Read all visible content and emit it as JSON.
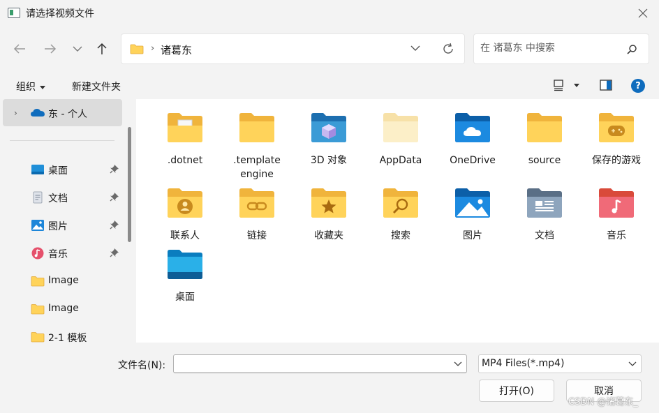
{
  "window": {
    "title": "请选择视频文件"
  },
  "nav": {
    "address_path": "诸葛东",
    "search_placeholder": "在 诸葛东 中搜索"
  },
  "toolbar": {
    "organize_label": "组织",
    "new_folder_label": "新建文件夹"
  },
  "sidebar": {
    "onedrive_label": "东 - 个人",
    "items": [
      {
        "label": "桌面",
        "icon": "desktop-icon",
        "pinned": true
      },
      {
        "label": "文档",
        "icon": "documents-icon",
        "pinned": true
      },
      {
        "label": "图片",
        "icon": "pictures-icon",
        "pinned": true
      },
      {
        "label": "音乐",
        "icon": "music-icon",
        "pinned": true
      },
      {
        "label": "Image",
        "icon": "folder-icon",
        "pinned": false
      },
      {
        "label": "Image",
        "icon": "folder-icon",
        "pinned": false
      },
      {
        "label": "2-1 模板",
        "icon": "folder-icon",
        "pinned": false
      }
    ]
  },
  "content": {
    "items": [
      {
        "label": ".dotnet",
        "icon": "folder-file-icon"
      },
      {
        "label": ".template engine",
        "icon": "folder-icon"
      },
      {
        "label": "3D 对象",
        "icon": "3d-objects-icon"
      },
      {
        "label": "AppData",
        "icon": "hidden-folder-icon"
      },
      {
        "label": "OneDrive",
        "icon": "onedrive-folder-icon"
      },
      {
        "label": "source",
        "icon": "folder-icon"
      },
      {
        "label": "保存的游戏",
        "icon": "saved-games-icon"
      },
      {
        "label": "联系人",
        "icon": "contacts-icon"
      },
      {
        "label": "链接",
        "icon": "links-icon"
      },
      {
        "label": "收藏夹",
        "icon": "favorites-icon"
      },
      {
        "label": "搜索",
        "icon": "searches-icon"
      },
      {
        "label": "图片",
        "icon": "pictures-folder-icon"
      },
      {
        "label": "文档",
        "icon": "documents-folder-icon"
      },
      {
        "label": "音乐",
        "icon": "music-folder-icon"
      },
      {
        "label": "桌面",
        "icon": "desktop-folder-icon"
      }
    ]
  },
  "footer": {
    "filename_label": "文件名(N):",
    "filename_value": "",
    "filetype_value": "MP4 Files(*.mp4)",
    "open_label": "打开(O)",
    "cancel_label": "取消"
  },
  "watermark": "CSDN @诸葛东_",
  "colors": {
    "accent": "#0f6cbd",
    "folder": "#ffd35a",
    "selection": "#dcdcdc"
  }
}
